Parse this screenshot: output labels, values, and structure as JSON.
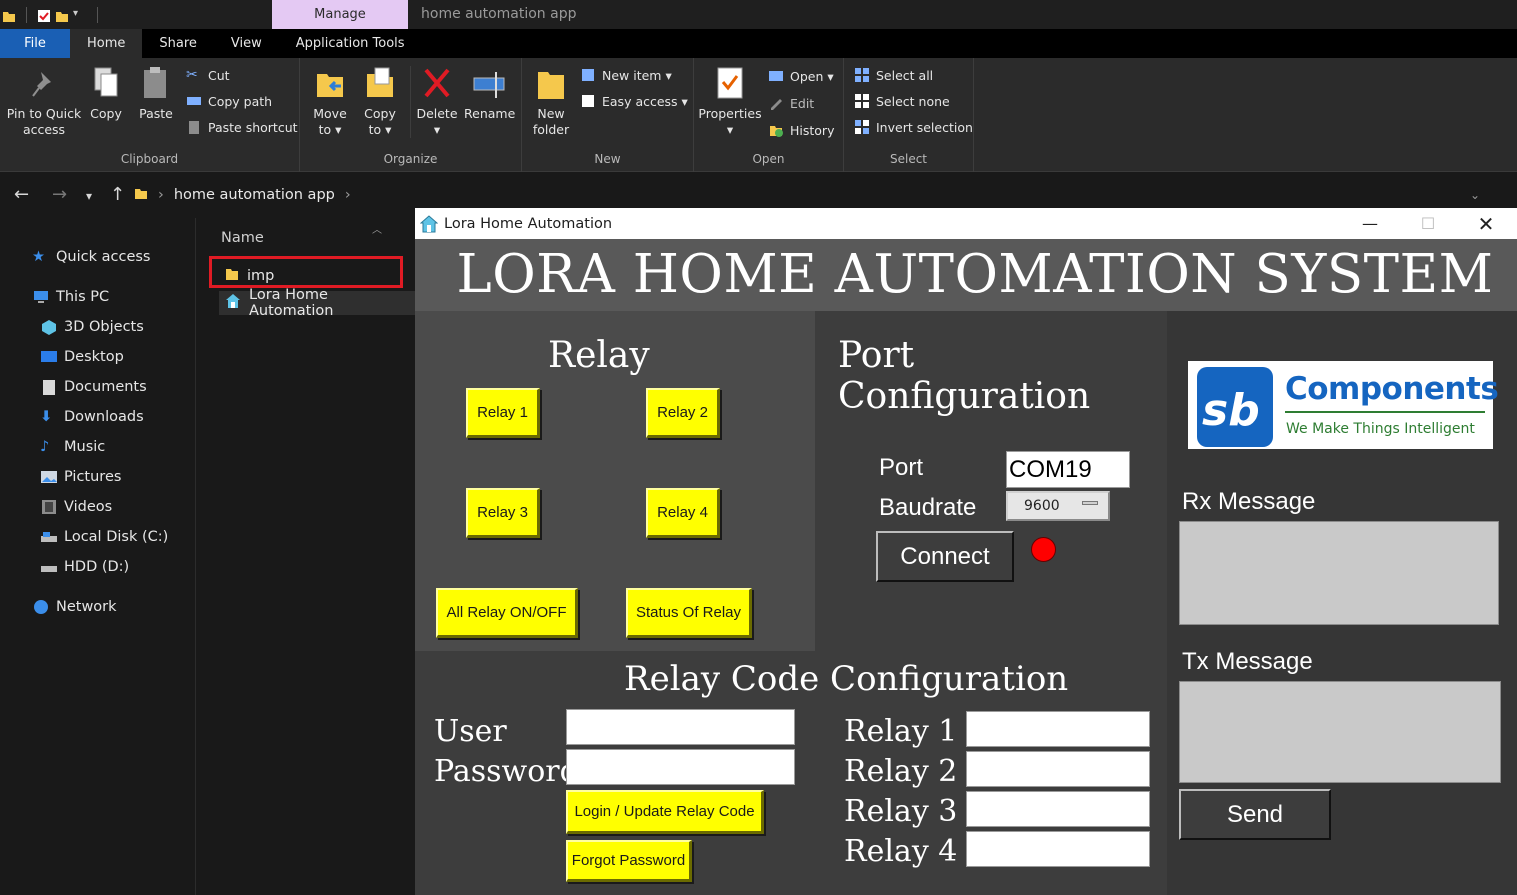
{
  "explorer": {
    "manage_tab": "Manage",
    "window_title": "home automation app",
    "tabs": [
      "File",
      "Home",
      "Share",
      "View",
      "Application Tools"
    ],
    "clipboard": {
      "pin_label_1": "Pin to Quick",
      "pin_label_2": "access",
      "copy": "Copy",
      "paste": "Paste",
      "cut": "Cut",
      "copy_path": "Copy path",
      "paste_shortcut": "Paste shortcut",
      "group": "Clipboard"
    },
    "organize": {
      "move_1": "Move",
      "move_2": "to ▾",
      "copy_1": "Copy",
      "copy_2": "to ▾",
      "delete": "Delete",
      "delete_caret": "▾",
      "rename": "Rename",
      "group": "Organize"
    },
    "new": {
      "new_folder_1": "New",
      "new_folder_2": "folder",
      "new_item": "New item ▾",
      "easy_access": "Easy access ▾",
      "group": "New"
    },
    "open": {
      "properties": "Properties",
      "properties_caret": "▾",
      "open": "Open ▾",
      "edit": "Edit",
      "history": "History",
      "group": "Open"
    },
    "select": {
      "select_all": "Select all",
      "select_none": "Select none",
      "invert": "Invert selection",
      "group": "Select"
    },
    "address": {
      "path": "home automation app",
      "sep": "›"
    },
    "sidebar": [
      {
        "label": "Quick access",
        "icon": "star-icon"
      },
      {
        "label": "This PC",
        "icon": "computer-icon"
      },
      {
        "label": "3D Objects",
        "icon": "cube-icon"
      },
      {
        "label": "Desktop",
        "icon": "desktop-icon"
      },
      {
        "label": "Documents",
        "icon": "documents-icon"
      },
      {
        "label": "Downloads",
        "icon": "download-icon"
      },
      {
        "label": "Music",
        "icon": "music-icon"
      },
      {
        "label": "Pictures",
        "icon": "pictures-icon"
      },
      {
        "label": "Videos",
        "icon": "videos-icon"
      },
      {
        "label": "Local Disk (C:)",
        "icon": "disk-icon"
      },
      {
        "label": "HDD (D:)",
        "icon": "disk-icon"
      },
      {
        "label": "Network",
        "icon": "network-icon"
      }
    ],
    "filelist": {
      "column": "Name",
      "files": [
        "imp",
        "Lora Home Automation"
      ]
    }
  },
  "app": {
    "title": "Lora Home Automation",
    "banner": "LORA HOME AUTOMATION SYSTEM",
    "relay": {
      "heading": "Relay",
      "buttons": [
        "Relay 1",
        "Relay 2",
        "Relay 3",
        "Relay 4"
      ],
      "all": "All Relay ON/OFF",
      "status": "Status Of Relay"
    },
    "port": {
      "heading": "Port Configuration",
      "port_label": "Port",
      "port_value": "COM19",
      "baud_label": "Baudrate",
      "baud_value": "9600",
      "connect": "Connect",
      "led_color": "#ff0000"
    },
    "code": {
      "heading": "Relay Code Configuration",
      "user": "User",
      "password": "Password",
      "login": "Login / Update Relay Code",
      "forgot": "Forgot Password",
      "relays": [
        "Relay 1",
        "Relay 2",
        "Relay 3",
        "Relay 4"
      ]
    },
    "logo": {
      "brand": "Components",
      "tagline": "We Make Things Intelligent"
    },
    "messages": {
      "rx": "Rx Message",
      "tx": "Tx Message",
      "send": "Send"
    }
  }
}
